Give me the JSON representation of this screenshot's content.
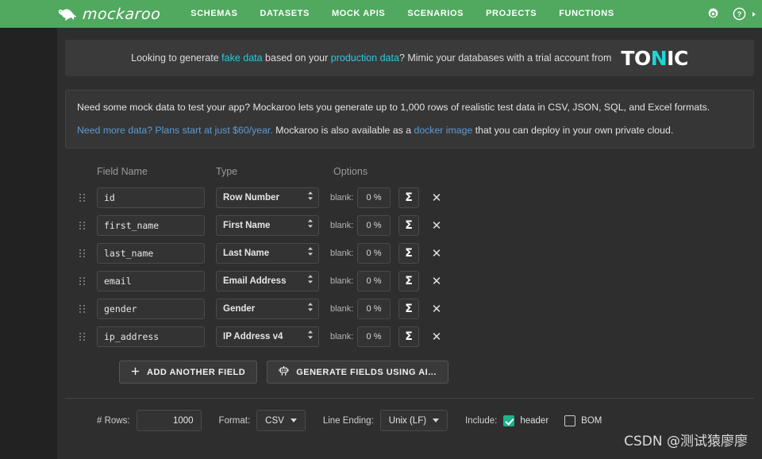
{
  "nav": {
    "logo_text": "mockaroo",
    "logo_icon": "kangaroo-icon",
    "items": [
      {
        "label": "SCHEMAS"
      },
      {
        "label": "DATASETS"
      },
      {
        "label": "MOCK APIS"
      },
      {
        "label": "SCENARIOS"
      },
      {
        "label": "PROJECTS"
      },
      {
        "label": "FUNCTIONS"
      }
    ],
    "settings_icon": "gear-icon",
    "help_icon": "help-circle-icon",
    "brand_color": "#51a85f"
  },
  "tonic_banner": {
    "text_part1": "Looking to generate ",
    "link1": "fake data",
    "text_part2": " based on your ",
    "link2": "production data",
    "text_part3": "? Mimic your databases with a trial account from",
    "logo_t": "T",
    "logo_o": "O",
    "logo_n": "N",
    "logo_ic": "IC",
    "link_color": "#2ec6e0",
    "accent_color": "#1fd6d6"
  },
  "infobox": {
    "line1": "Need some mock data to test your app? Mockaroo lets you generate up to 1,000 rows of realistic test data in CSV, JSON, SQL, and Excel formats.",
    "line2_link1": "Need more data? Plans start at just $60/year.",
    "line2_mid": " Mockaroo is also available as a ",
    "line2_link2": "docker image",
    "line2_end": " that you can deploy in your own private cloud.",
    "link_color": "#5b9bd5"
  },
  "fields_table": {
    "headers": {
      "name": "Field Name",
      "type": "Type",
      "options": "Options"
    },
    "blank_label": "blank:",
    "sigma_label": "Σ",
    "remove_label": "✕",
    "drag_icon": "drag-handle-icon",
    "rows": [
      {
        "name": "id",
        "type": "Row Number",
        "blank": "0 %"
      },
      {
        "name": "first_name",
        "type": "First Name",
        "blank": "0 %"
      },
      {
        "name": "last_name",
        "type": "Last Name",
        "blank": "0 %"
      },
      {
        "name": "email",
        "type": "Email Address",
        "blank": "0 %"
      },
      {
        "name": "gender",
        "type": "Gender",
        "blank": "0 %"
      },
      {
        "name": "ip_address",
        "type": "IP Address v4",
        "blank": "0 %"
      }
    ]
  },
  "actions": {
    "add_field": "ADD ANOTHER FIELD",
    "add_field_icon": "plus-icon",
    "generate_ai": "GENERATE FIELDS USING AI...",
    "generate_ai_icon": "robot-icon"
  },
  "bottombar": {
    "rows_label": "# Rows:",
    "rows_value": "1000",
    "format_label": "Format:",
    "format_value": "CSV",
    "line_ending_label": "Line Ending:",
    "line_ending_value": "Unix (LF)",
    "include_label": "Include:",
    "header_label": "header",
    "header_checked": true,
    "bom_label": "BOM",
    "bom_checked": false,
    "checked_color": "#1bb48a"
  },
  "watermark": {
    "text": "CSDN @测试猿廖廖"
  }
}
